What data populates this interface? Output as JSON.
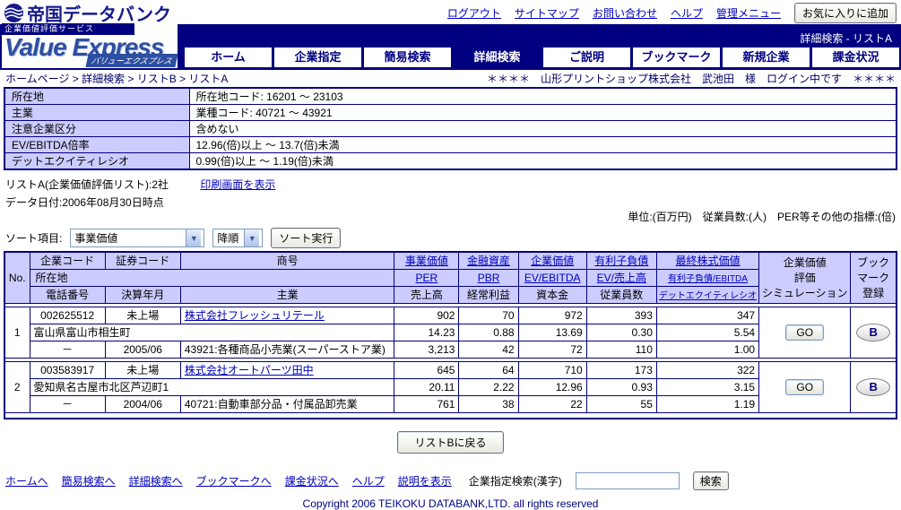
{
  "colors": {
    "navy": "#000080",
    "header_bg": "#ccccff",
    "link": "#0000bb"
  },
  "topbar": {
    "logo": "帝国データバンク",
    "links": [
      "ログアウト",
      "サイトマップ",
      "お問い合わせ",
      "ヘルプ",
      "管理メニュー"
    ],
    "favorite_button": "お気に入りに追加"
  },
  "banner": {
    "service_label": "企業価値評価サービス",
    "brand": "Value Express",
    "brand_kana": "バリューエクスプレス",
    "page_indicator": "詳細検索 - リストA",
    "tabs": [
      {
        "label": "ホーム"
      },
      {
        "label": "企業指定"
      },
      {
        "label": "簡易検索"
      },
      {
        "label": "詳細検索"
      },
      {
        "label": "ご説明"
      },
      {
        "label": "ブックマーク"
      },
      {
        "label": "新規企業"
      },
      {
        "label": "課金状況"
      }
    ]
  },
  "breadcrumb": "ホームページ > 詳細検索 > リストB > リストA",
  "login_status": "＊＊＊＊　山形プリントショップ株式会社　武池田　様　ログイン中です　＊＊＊＊",
  "conditions": {
    "rows": [
      {
        "label": "所在地",
        "value": "所在地コード: 16201 ～ 23103"
      },
      {
        "label": "主業",
        "value": "業種コード: 40721 ～ 43921"
      },
      {
        "label": "注意企業区分",
        "value": "含めない"
      },
      {
        "label": "EV/EBITDA倍率",
        "value": "12.96(倍)以上 ～ 13.7(倍)未満"
      },
      {
        "label": "デットエクイティレシオ",
        "value": "0.99(倍)以上 ～ 1.19(倍)未満"
      }
    ]
  },
  "list_info": {
    "title": "リストA(企業価値評価リスト):2社",
    "print_link": "印刷画面を表示",
    "data_date": "データ日付:2006年08月30日時点",
    "units_note": "単位:(百万円)　従業員数:(人)　PER等その他の指標:(倍)"
  },
  "sort": {
    "label": "ソート項目:",
    "field": "事業価値",
    "order": "降順",
    "execute": "ソート実行"
  },
  "table": {
    "header": {
      "no": "No.",
      "company_code": "企業コード",
      "stock_code": "証券コード",
      "trade_name": "商号",
      "business_value": "事業価値",
      "financial_assets": "金融資産",
      "enterprise_value": "企業価値",
      "interest_debt": "有利子負債",
      "final_equity": "最終株式価値",
      "address": "所在地",
      "per": "PER",
      "pbr": "PBR",
      "ev_ebitda": "EV/EBITDA",
      "ev_sales": "EV/売上高",
      "debt_ebitda": "有利子負債/EBITDA",
      "phone": "電話番号",
      "fiscal": "決算年月",
      "main_business": "主業",
      "sales": "売上高",
      "ordinary_profit": "経常利益",
      "capital": "資本金",
      "employees": "従業員数",
      "de_ratio": "デットエクイティレシオ",
      "sim_l1": "企業価値",
      "sim_l2": "評価",
      "sim_l3": "シミュレーション",
      "bm_l1": "ブック",
      "bm_l2": "マーク",
      "bm_l3": "登録"
    },
    "rows": [
      {
        "no": "1",
        "company_code": "002625512",
        "stock_code": "未上場",
        "name": "株式会社フレッシュリテール",
        "address": "富山県富山市相生町",
        "phone": "－",
        "fiscal": "2005/06",
        "industry": "43921:各種商品小売業(スーパーストア業)",
        "business_value": "902",
        "per": "14.23",
        "sales": "3,213",
        "financial_assets": "70",
        "pbr": "0.88",
        "ordinary_profit": "42",
        "enterprise_value": "972",
        "ev_ebitda": "13.69",
        "capital": "72",
        "interest_debt": "393",
        "ev_sales": "0.30",
        "employees": "110",
        "final_equity": "347",
        "debt_ebitda": "5.54",
        "de_ratio": "1.00",
        "go": "GO",
        "bookmark": "B"
      },
      {
        "no": "2",
        "company_code": "003583917",
        "stock_code": "未上場",
        "name": "株式会社オートパーツ田中",
        "address": "愛知県名古屋市北区芦辺町1",
        "phone": "－",
        "fiscal": "2004/06",
        "industry": "40721:自動車部分品・付属品卸売業",
        "business_value": "645",
        "per": "20.11",
        "sales": "761",
        "financial_assets": "64",
        "pbr": "2.22",
        "ordinary_profit": "38",
        "enterprise_value": "710",
        "ev_ebitda": "12.96",
        "capital": "22",
        "interest_debt": "173",
        "ev_sales": "0.93",
        "employees": "55",
        "final_equity": "322",
        "debt_ebitda": "3.15",
        "de_ratio": "1.19",
        "go": "GO",
        "bookmark": "B"
      }
    ]
  },
  "back_button": "リストBに戻る",
  "footer": {
    "links": [
      "ホームへ",
      "簡易検索へ",
      "詳細検索へ",
      "ブックマークへ",
      "課金状況へ",
      "ヘルプ",
      "説明を表示"
    ],
    "company_search_label": "企業指定検索(漢字)",
    "search_button": "検索",
    "copyright": "Copyright 2006 TEIKOKU DATABANK,LTD. all rights reserved"
  }
}
